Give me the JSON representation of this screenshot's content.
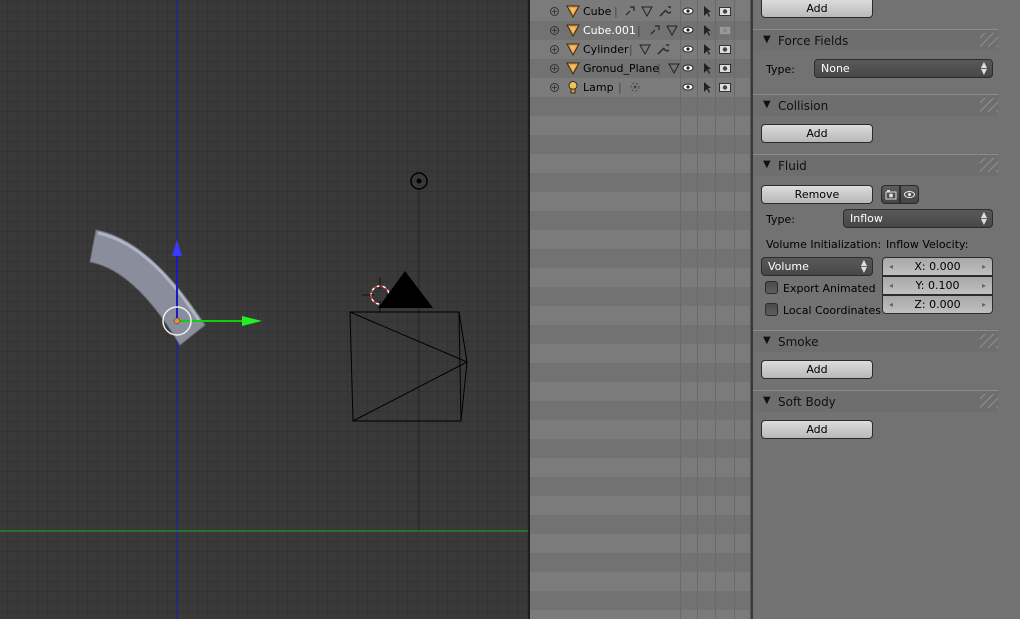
{
  "outliner": {
    "rows": [
      {
        "name": "Cube",
        "selected": false,
        "icon": "mesh-triangle-icon"
      },
      {
        "name": "Cube.001",
        "selected": true,
        "icon": "mesh-triangle-icon"
      },
      {
        "name": "Cylinder",
        "selected": false,
        "icon": "mesh-triangle-icon"
      },
      {
        "name": "Gronud_Plane",
        "selected": false,
        "icon": "mesh-triangle-icon"
      },
      {
        "name": "Lamp",
        "selected": false,
        "icon": "lamp-bulb-icon"
      }
    ],
    "expand_glyph": "+"
  },
  "properties": {
    "add_top_label": "Add",
    "force_fields": {
      "title": "Force Fields",
      "type_label": "Type:",
      "type_value": "None"
    },
    "collision": {
      "title": "Collision",
      "add_label": "Add"
    },
    "fluid": {
      "title": "Fluid",
      "remove_label": "Remove",
      "type_label": "Type:",
      "type_value": "Inflow",
      "volume_init_label": "Volume Initialization:",
      "volume_init_value": "Volume",
      "inflow_velocity_label": "Inflow Velocity:",
      "export_animated_label": "Export Animated",
      "export_animated_checked": false,
      "local_coordinates_label": "Local Coordinates",
      "local_coordinates_checked": false,
      "vel_x": "X: 0.000",
      "vel_y": "Y: 0.100",
      "vel_z": "Z: 0.000"
    },
    "smoke": {
      "title": "Smoke",
      "add_label": "Add"
    },
    "soft_body": {
      "title": "Soft Body",
      "add_label": "Add"
    }
  },
  "colors": {
    "accent_axis_x": "#1faa1f",
    "accent_axis_z": "#1a1abf",
    "selected_text": "#ffffff"
  },
  "glyphs": {
    "panel_triangle": "▼",
    "dropdown_arrows": "▲▼",
    "left_arrow": "◂",
    "right_arrow": "▸"
  }
}
